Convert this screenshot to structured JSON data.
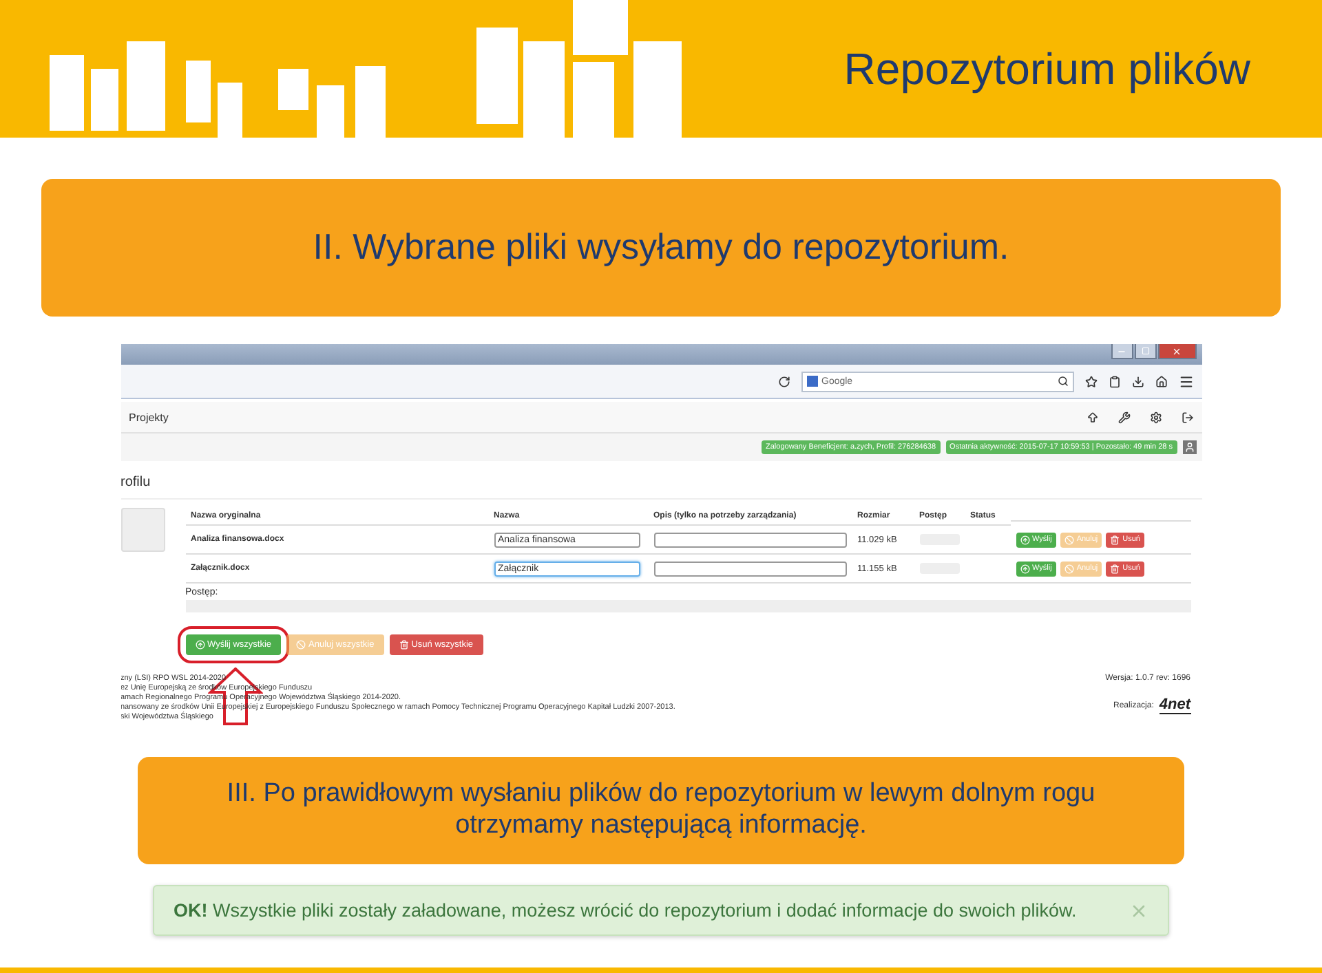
{
  "header": {
    "title": "Repozytorium plików"
  },
  "step_banner": {
    "text": "II. Wybrane pliki wysyłamy do repozytorium."
  },
  "screenshot": {
    "browser": {
      "search_value": "Google"
    },
    "navbar": {
      "title": "Projekty"
    },
    "status_badges": [
      "Zalogowany Beneficjent: a.zych, Profil: 276284638",
      "Ostatnia aktywność: 2015-07-17 10:59:53 | Pozostało: 49 min 28 s"
    ],
    "section_title": "rofilu",
    "table": {
      "columns": [
        "Nazwa oryginalna",
        "Nazwa",
        "Opis (tylko na potrzeby zarządzania)",
        "Rozmiar",
        "Postęp",
        "Status"
      ],
      "rows": [
        {
          "original_name": "Analiza finansowa.docx",
          "name": "Analiza finansowa",
          "focused": false,
          "size": "11.029 kB",
          "level": 0,
          "actions": [
            {
              "kind": "send",
              "label": "Wyślij"
            },
            {
              "kind": "cancel",
              "label": "Anuluj"
            },
            {
              "kind": "delete",
              "label": "Usuń"
            }
          ]
        },
        {
          "original_name": "Załącznik.docx",
          "name": "Załącznik",
          "focused": true,
          "size": "11.155 kB",
          "level": 0,
          "actions": [
            {
              "kind": "send",
              "label": "Wyślij"
            },
            {
              "kind": "cancel",
              "label": "Anuluj"
            },
            {
              "kind": "delete",
              "label": "Usuń"
            }
          ]
        }
      ]
    },
    "progress": {
      "label": "Postęp:",
      "level": 0
    },
    "bulk_actions": [
      {
        "kind": "send",
        "label": "Wyślij wszystkie",
        "highlighted": true
      },
      {
        "kind": "cancel",
        "label": "Anuluj wszystkie",
        "highlighted": false
      },
      {
        "kind": "delete",
        "label": "Usuń wszystkie",
        "highlighted": false
      }
    ],
    "footer": {
      "lines": [
        "zny (LSI) RPO WSL 2014-2020",
        "ez Unię Europejską ze środków Europejskiego Funduszu",
        "amach Regionalnego Programu Operacyjnego Województwa Śląskiego 2014-2020.",
        "nansowany ze środków Unii Europejskiej z Europejskiego Funduszu Społecznego w ramach Pomocy Technicznej Programu Operacyjnego Kapitał Ludzki 2007-2013.",
        "ski Województwa Śląskiego"
      ],
      "version": "Wersja: 1.0.7 rev: 1696",
      "credit_label": "Realizacja:",
      "credit_logo": "4net"
    }
  },
  "info_banner": {
    "text": "III. Po prawidłowym wysłaniu plików do repozytorium w lewym dolnym rogu otrzymamy następującą informację."
  },
  "alert": {
    "text": "**OK!** Wszystkie pliki zostały załadowane, możesz wrócić do repozytorium i dodać informacje do swoich plików.",
    "dismissible": true
  }
}
